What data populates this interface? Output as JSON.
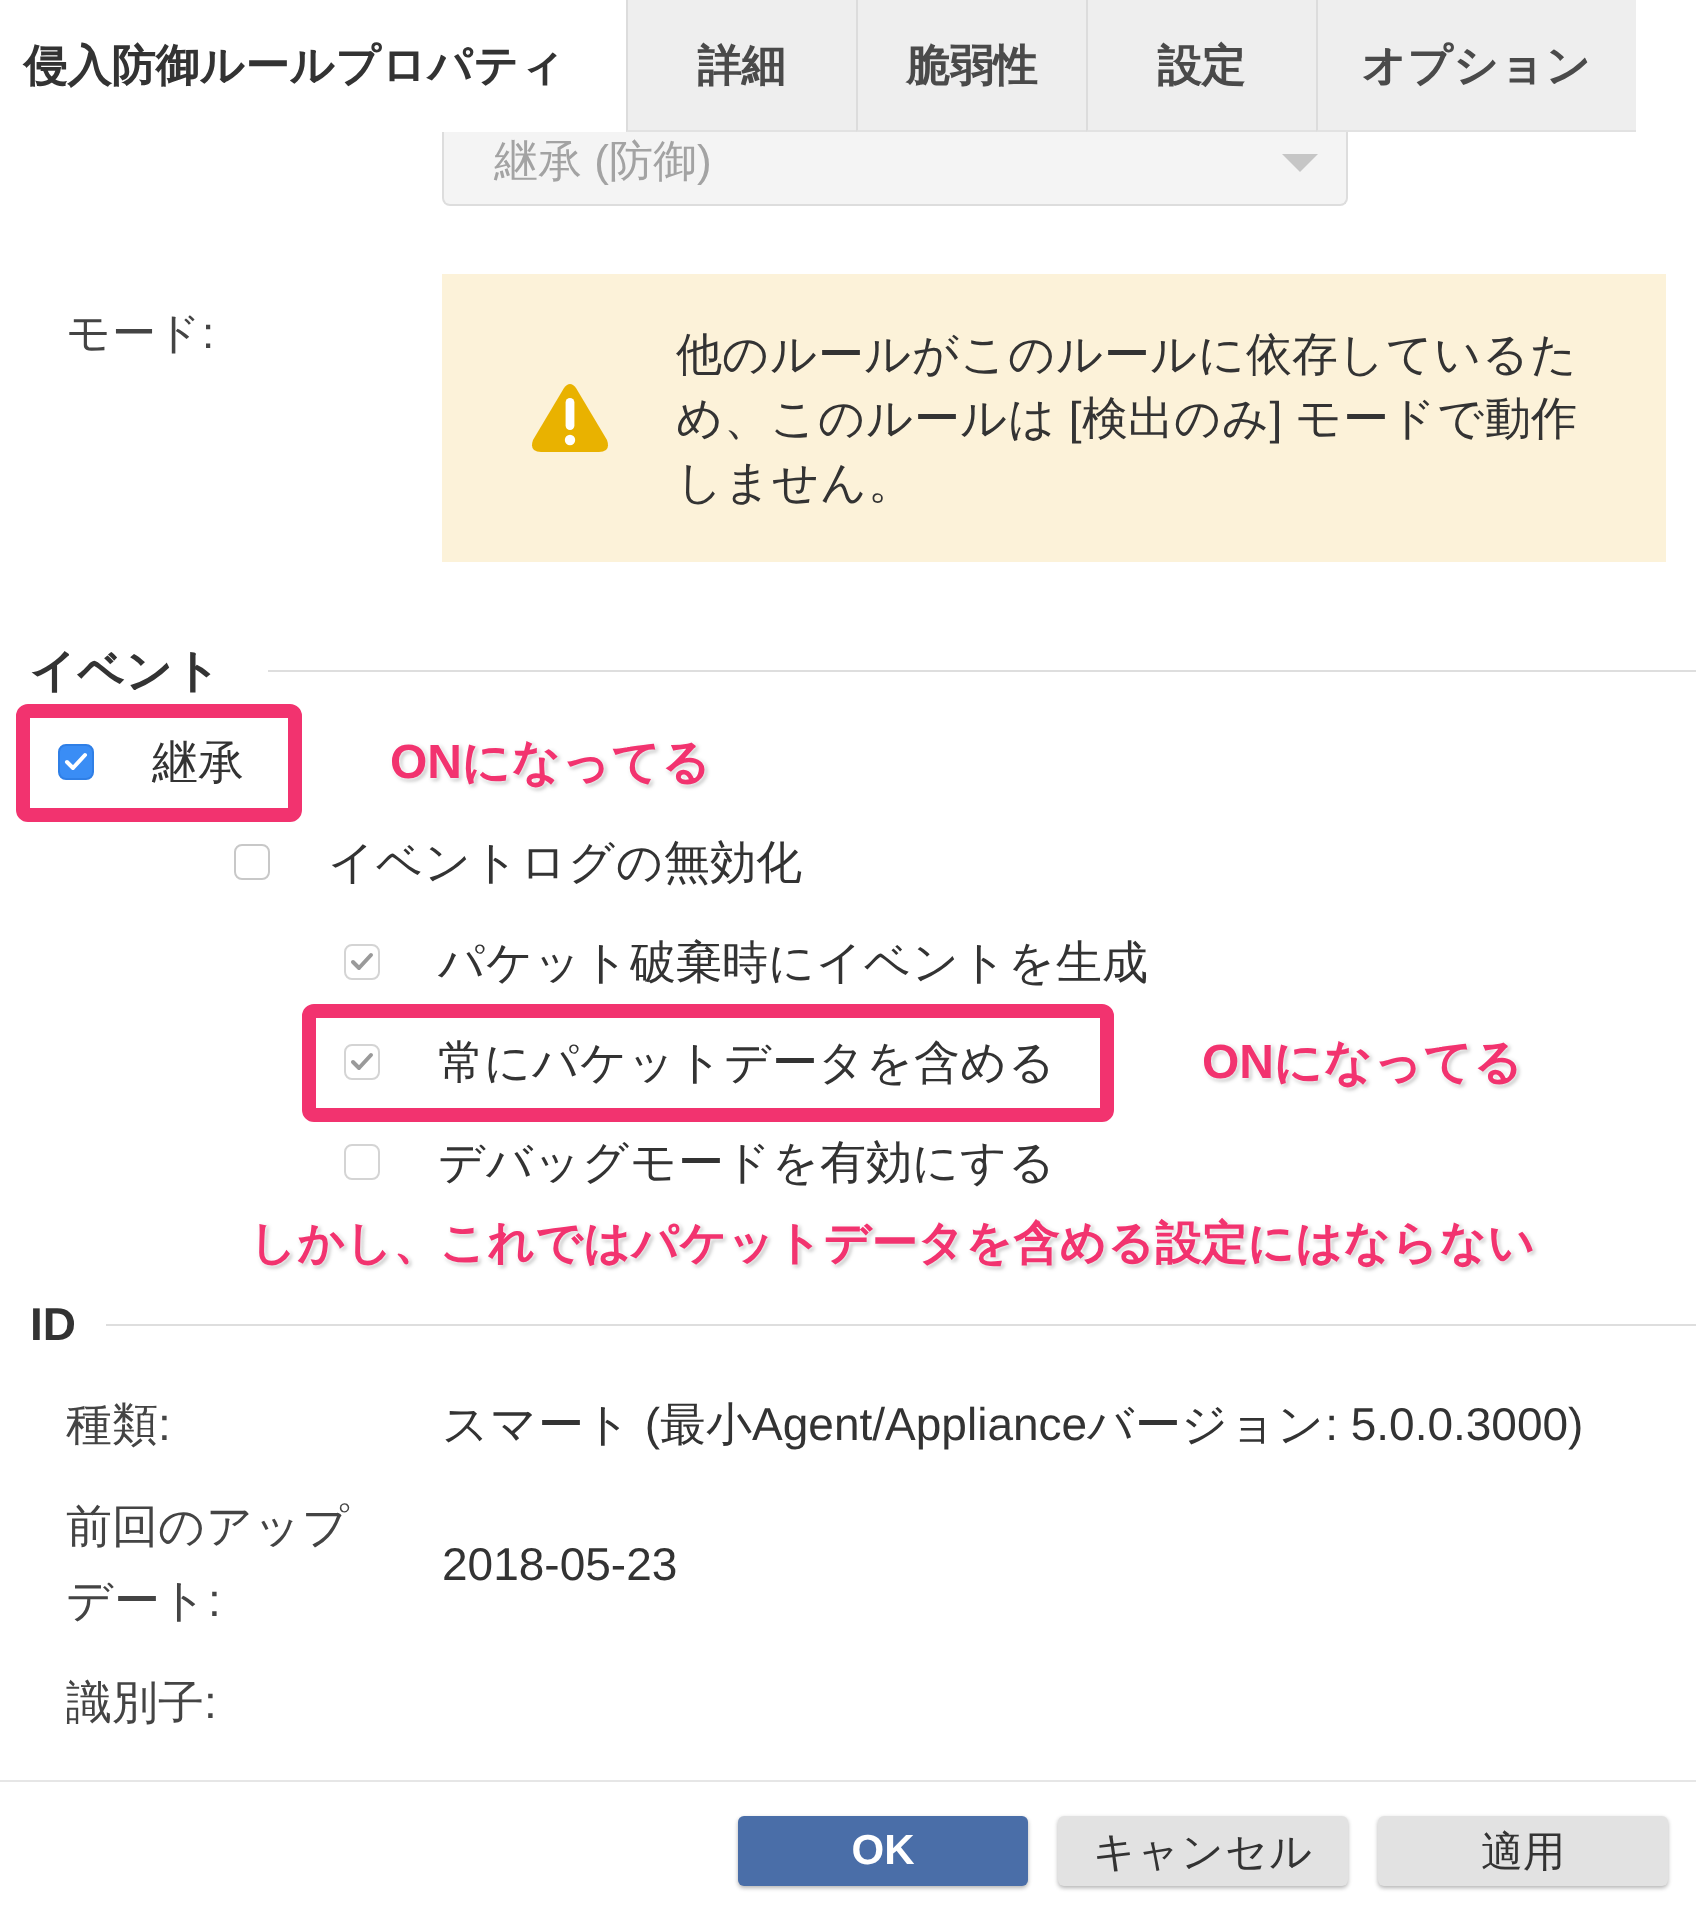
{
  "tabs": [
    {
      "label": "侵入防御ルールプロパティ",
      "selected": true
    },
    {
      "label": "詳細",
      "selected": false
    },
    {
      "label": "脆弱性",
      "selected": false
    },
    {
      "label": "設定",
      "selected": false
    },
    {
      "label": "オプション",
      "selected": false
    }
  ],
  "select": {
    "value": "継承 (防御)",
    "disabled": true
  },
  "mode": {
    "label": "モード:",
    "warning": "他のルールがこのルールに依存しているため、このルールは [検出のみ] モードで動作しません。"
  },
  "events": {
    "title": "イベント",
    "items": [
      {
        "label": "継承",
        "checked": true,
        "disabled": false,
        "highlighted": true,
        "note": "ONになってる",
        "children": [
          {
            "label": "イベントログの無効化",
            "checked": false,
            "disabled": false,
            "highlighted": false,
            "children": [
              {
                "label": "パケット破棄時にイベントを生成",
                "checked": true,
                "disabled": true,
                "highlighted": false
              },
              {
                "label": "常にパケットデータを含める",
                "checked": true,
                "disabled": true,
                "highlighted": true,
                "note": "ONになってる"
              },
              {
                "label": "デバッグモードを有効にする",
                "checked": false,
                "disabled": true,
                "highlighted": false
              }
            ]
          }
        ]
      }
    ],
    "annotation": "しかし、これではパケットデータを含める設定にはならない"
  },
  "id_section": {
    "title": "ID",
    "rows": [
      {
        "label": "種類:",
        "value": "スマート (最小Agent/Applianceバージョン: 5.0.0.3000)"
      },
      {
        "label": "前回のアップデート:",
        "value": "2018-05-23"
      },
      {
        "label": "識別子:"
      }
    ]
  },
  "buttons": [
    {
      "label": "OK",
      "kind": "primary"
    },
    {
      "label": "キャンセル",
      "kind": "secondary"
    },
    {
      "label": "適用",
      "kind": "secondary"
    }
  ]
}
